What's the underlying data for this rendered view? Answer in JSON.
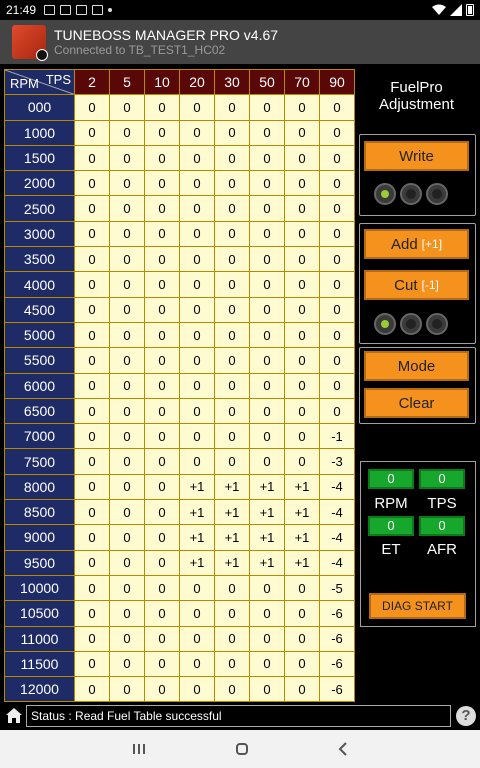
{
  "statusbar": {
    "time": "21:49"
  },
  "app": {
    "title": "TUNEBOSS MANAGER PRO v4.67",
    "subtitle": "Connected to TB_TEST1_HC02"
  },
  "table": {
    "corner_rpm": "RPM",
    "corner_tps": "TPS",
    "tps_headers": [
      "2",
      "5",
      "10",
      "20",
      "30",
      "50",
      "70",
      "90"
    ],
    "rows": [
      {
        "rpm": "000",
        "values": [
          "0",
          "0",
          "0",
          "0",
          "0",
          "0",
          "0",
          "0"
        ]
      },
      {
        "rpm": "1000",
        "values": [
          "0",
          "0",
          "0",
          "0",
          "0",
          "0",
          "0",
          "0"
        ]
      },
      {
        "rpm": "1500",
        "values": [
          "0",
          "0",
          "0",
          "0",
          "0",
          "0",
          "0",
          "0"
        ]
      },
      {
        "rpm": "2000",
        "values": [
          "0",
          "0",
          "0",
          "0",
          "0",
          "0",
          "0",
          "0"
        ]
      },
      {
        "rpm": "2500",
        "values": [
          "0",
          "0",
          "0",
          "0",
          "0",
          "0",
          "0",
          "0"
        ]
      },
      {
        "rpm": "3000",
        "values": [
          "0",
          "0",
          "0",
          "0",
          "0",
          "0",
          "0",
          "0"
        ]
      },
      {
        "rpm": "3500",
        "values": [
          "0",
          "0",
          "0",
          "0",
          "0",
          "0",
          "0",
          "0"
        ]
      },
      {
        "rpm": "4000",
        "values": [
          "0",
          "0",
          "0",
          "0",
          "0",
          "0",
          "0",
          "0"
        ]
      },
      {
        "rpm": "4500",
        "values": [
          "0",
          "0",
          "0",
          "0",
          "0",
          "0",
          "0",
          "0"
        ]
      },
      {
        "rpm": "5000",
        "values": [
          "0",
          "0",
          "0",
          "0",
          "0",
          "0",
          "0",
          "0"
        ]
      },
      {
        "rpm": "5500",
        "values": [
          "0",
          "0",
          "0",
          "0",
          "0",
          "0",
          "0",
          "0"
        ]
      },
      {
        "rpm": "6000",
        "values": [
          "0",
          "0",
          "0",
          "0",
          "0",
          "0",
          "0",
          "0"
        ]
      },
      {
        "rpm": "6500",
        "values": [
          "0",
          "0",
          "0",
          "0",
          "0",
          "0",
          "0",
          "0"
        ]
      },
      {
        "rpm": "7000",
        "values": [
          "0",
          "0",
          "0",
          "0",
          "0",
          "0",
          "0",
          "-1"
        ]
      },
      {
        "rpm": "7500",
        "values": [
          "0",
          "0",
          "0",
          "0",
          "0",
          "0",
          "0",
          "-3"
        ]
      },
      {
        "rpm": "8000",
        "values": [
          "0",
          "0",
          "0",
          "+1",
          "+1",
          "+1",
          "+1",
          "-4"
        ]
      },
      {
        "rpm": "8500",
        "values": [
          "0",
          "0",
          "0",
          "+1",
          "+1",
          "+1",
          "+1",
          "-4"
        ]
      },
      {
        "rpm": "9000",
        "values": [
          "0",
          "0",
          "0",
          "+1",
          "+1",
          "+1",
          "+1",
          "-4"
        ]
      },
      {
        "rpm": "9500",
        "values": [
          "0",
          "0",
          "0",
          "+1",
          "+1",
          "+1",
          "+1",
          "-4"
        ]
      },
      {
        "rpm": "10000",
        "values": [
          "0",
          "0",
          "0",
          "0",
          "0",
          "0",
          "0",
          "-5"
        ]
      },
      {
        "rpm": "10500",
        "values": [
          "0",
          "0",
          "0",
          "0",
          "0",
          "0",
          "0",
          "-6"
        ]
      },
      {
        "rpm": "11000",
        "values": [
          "0",
          "0",
          "0",
          "0",
          "0",
          "0",
          "0",
          "-6"
        ]
      },
      {
        "rpm": "11500",
        "values": [
          "0",
          "0",
          "0",
          "0",
          "0",
          "0",
          "0",
          "-6"
        ]
      },
      {
        "rpm": "12000",
        "values": [
          "0",
          "0",
          "0",
          "0",
          "0",
          "0",
          "0",
          "-6"
        ]
      }
    ]
  },
  "side": {
    "title_line1": "FuelPro",
    "title_line2": "Adjustment",
    "write_label": "Write",
    "add_label": "Add",
    "add_bracket": "[+1]",
    "cut_label": "Cut",
    "cut_bracket": "[-1]",
    "mode_label": "Mode",
    "clear_label": "Clear",
    "write_leds": [
      "on",
      "off",
      "off"
    ],
    "adj_leds": [
      "on",
      "off",
      "off"
    ]
  },
  "diag": {
    "rpm_value": "0",
    "tps_value": "0",
    "et_value": "0",
    "afr_value": "0",
    "rpm_label": "RPM",
    "tps_label": "TPS",
    "et_label": "ET",
    "afr_label": "AFR",
    "start_label": "DIAG START"
  },
  "status": {
    "text": "Status : Read Fuel Table successful"
  },
  "colors": {
    "accent": "#f5921e",
    "row_header": "#1f2b66",
    "col_header": "#5a0708",
    "cell": "#fffbd0",
    "gauge": "#16a72c"
  }
}
